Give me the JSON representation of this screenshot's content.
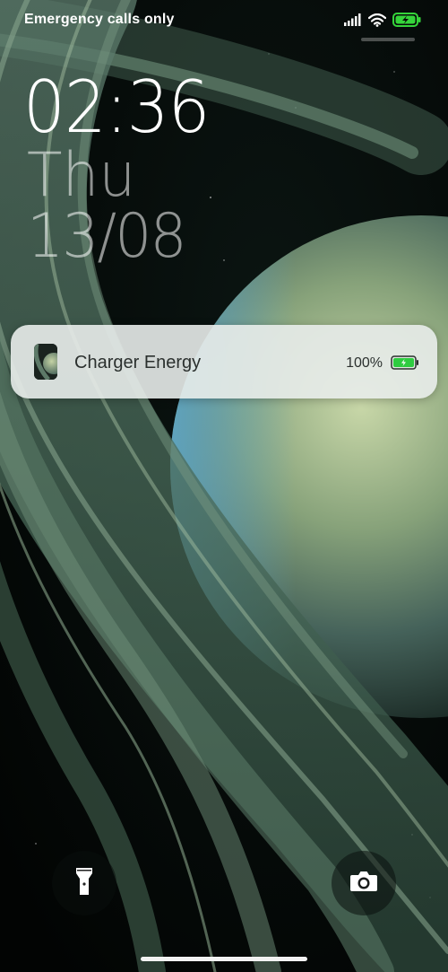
{
  "status_bar": {
    "carrier_text": "Emergency calls only",
    "icons": [
      "signal-icon",
      "wifi-icon",
      "battery-charging-icon"
    ]
  },
  "lockscreen": {
    "time": "02:36",
    "day": "Thu",
    "date": "13/08"
  },
  "notification": {
    "app_icon": "charger-energy-app-icon",
    "title": "Charger Energy",
    "battery_percent": "100%",
    "battery_icon": "battery-charging-icon",
    "battery_level": 1.0,
    "battery_color": "#2ecc40"
  },
  "shortcuts": {
    "left": "flashlight-icon",
    "right": "camera-icon"
  },
  "colors": {
    "battery_status": "#35d43a",
    "notification_bg": "#e8ecea"
  }
}
